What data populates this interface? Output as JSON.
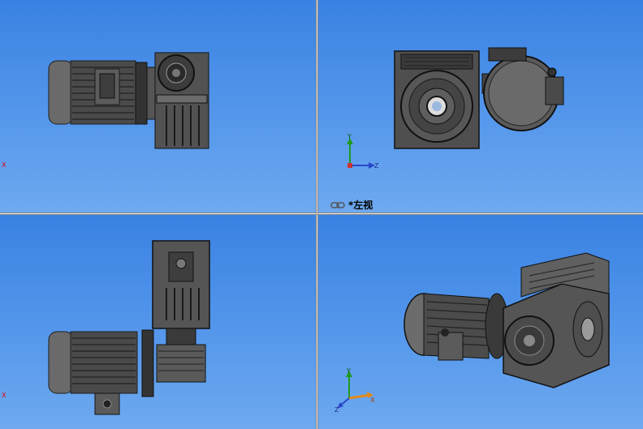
{
  "toolbar": {
    "icons": [
      "zoom-to-fit-icon",
      "zoom-to-area-icon",
      "rotate-view-icon",
      "section-view-icon",
      "view-orientation-icon",
      "display-style-icon",
      "hide-show-items-icon",
      "edit-appearance-icon",
      "apply-scene-icon",
      "view-settings-icon"
    ]
  },
  "viewports": {
    "top_right": {
      "view_name": "*左视"
    }
  },
  "triad": {
    "y_label": "Y",
    "z_label": "Z",
    "x_label": "X"
  },
  "colors": {
    "viewport_top": "#3a82e2",
    "viewport_bottom": "#6ea9f0",
    "model_dark": "#2b2b2b",
    "model_mid": "#5a5a5a",
    "model_light": "#8a8a8a"
  }
}
